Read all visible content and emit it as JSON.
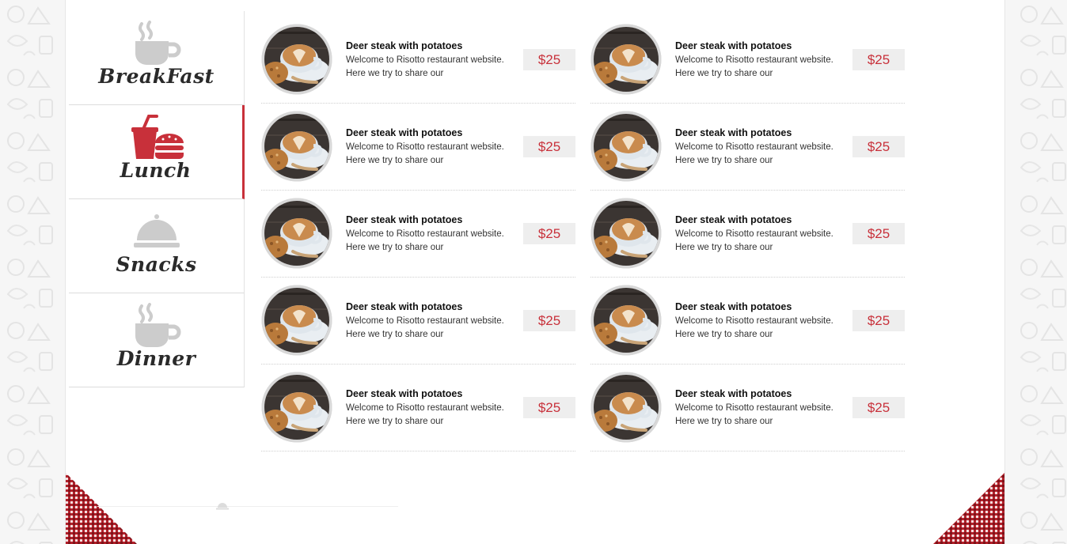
{
  "tabs": [
    {
      "label": "BreakFast",
      "icon": "coffee-cup-icon",
      "active": false
    },
    {
      "label": "Lunch",
      "icon": "soda-burger-icon",
      "active": true
    },
    {
      "label": "Snacks",
      "icon": "cloche-icon",
      "active": false
    },
    {
      "label": "Dinner",
      "icon": "coffee-cup-icon",
      "active": false
    }
  ],
  "menu": {
    "items": [
      {
        "name": "Deer steak with potatoes",
        "description": "Welcome to Risotto restaurant website. Here we try to share our",
        "price": "$25"
      },
      {
        "name": "Deer steak with potatoes",
        "description": "Welcome to Risotto restaurant website. Here we try to share our",
        "price": "$25"
      },
      {
        "name": "Deer steak with potatoes",
        "description": "Welcome to Risotto restaurant website. Here we try to share our",
        "price": "$25"
      },
      {
        "name": "Deer steak with potatoes",
        "description": "Welcome to Risotto restaurant website. Here we try to share our",
        "price": "$25"
      },
      {
        "name": "Deer steak with potatoes",
        "description": "Welcome to Risotto restaurant website. Here we try to share our",
        "price": "$25"
      },
      {
        "name": "Deer steak with potatoes",
        "description": "Welcome to Risotto restaurant website. Here we try to share our",
        "price": "$25"
      },
      {
        "name": "Deer steak with potatoes",
        "description": "Welcome to Risotto restaurant website. Here we try to share our",
        "price": "$25"
      },
      {
        "name": "Deer steak with potatoes",
        "description": "Welcome to Risotto restaurant website. Here we try to share our",
        "price": "$25"
      },
      {
        "name": "Deer steak with potatoes",
        "description": "Welcome to Risotto restaurant website. Here we try to share our",
        "price": "$25"
      },
      {
        "name": "Deer steak with potatoes",
        "description": "Welcome to Risotto restaurant website. Here we try to share our",
        "price": "$25"
      }
    ]
  },
  "colors": {
    "accent": "#c8303a",
    "icon_inactive": "#cccccc",
    "price_bg": "#eeeeee"
  }
}
